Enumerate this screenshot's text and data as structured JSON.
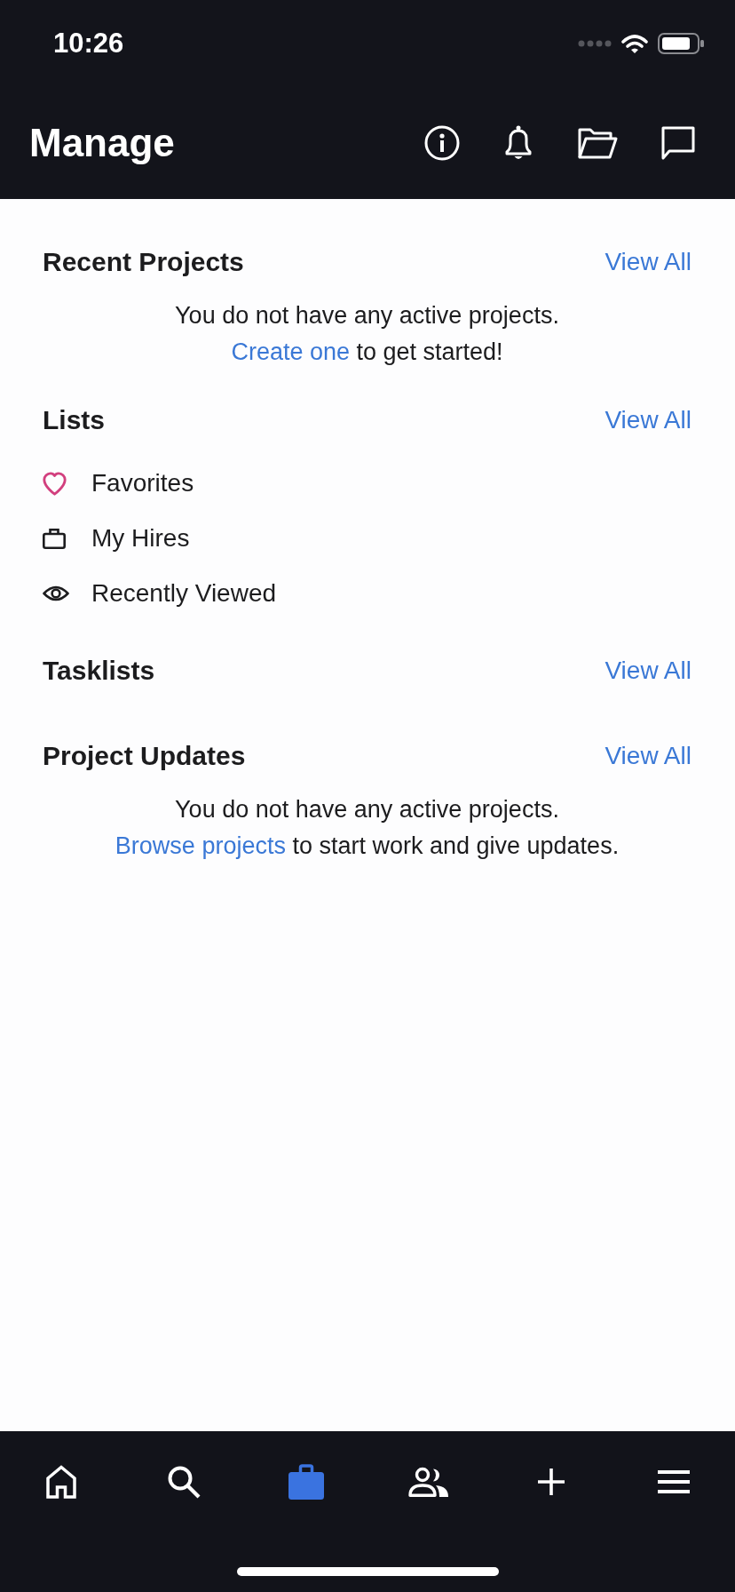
{
  "status_bar": {
    "time": "10:26"
  },
  "header": {
    "title": "Manage"
  },
  "sections": [
    {
      "kind": "empty",
      "title": "Recent Projects",
      "action": "View All",
      "message": "You do not have any active projects.",
      "link": "Create one",
      "link_after": "to get started!"
    },
    {
      "kind": "list",
      "title": "Lists",
      "action": "View All",
      "items": [
        {
          "label": "Favorites",
          "color": "#d23f7e"
        },
        {
          "label": "My Hires",
          "color": "#1c1c1e"
        },
        {
          "label": "Recently Viewed",
          "color": "#1c1c1e"
        }
      ]
    },
    {
      "kind": "plain",
      "title": "Tasklists",
      "action": "View All"
    },
    {
      "kind": "empty",
      "title": "Project Updates",
      "action": "View All",
      "message": "You do not have any active projects.",
      "link": "Browse projects",
      "link_after": "to start work and give updates."
    }
  ],
  "tab_bar": {
    "tabs": [
      {
        "selected": false
      },
      {
        "selected": false
      },
      {
        "selected": true
      },
      {
        "selected": false
      },
      {
        "selected": false
      },
      {
        "selected": false
      }
    ]
  }
}
